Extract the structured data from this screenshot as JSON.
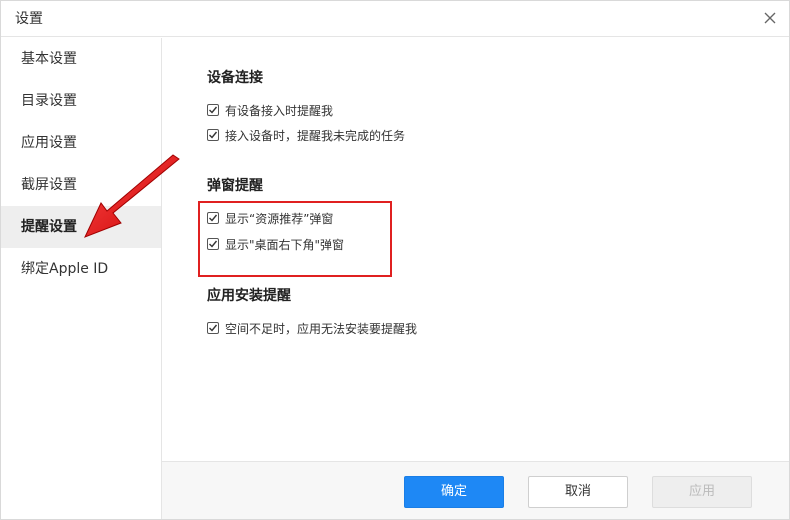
{
  "window": {
    "title": "设置"
  },
  "sidebar": {
    "items": [
      {
        "label": "基本设置"
      },
      {
        "label": "目录设置"
      },
      {
        "label": "应用设置"
      },
      {
        "label": "截屏设置"
      },
      {
        "label": "提醒设置",
        "active": true
      },
      {
        "label": "绑定Apple ID"
      }
    ]
  },
  "content": {
    "sections": [
      {
        "title": "设备连接",
        "options": [
          {
            "label": "有设备接入时提醒我",
            "checked": true
          },
          {
            "label": "接入设备时，提醒我未完成的任务",
            "checked": true
          }
        ]
      },
      {
        "title": "弹窗提醒",
        "options": [
          {
            "label": "显示“资源推荐”弹窗",
            "checked": true
          },
          {
            "label": "显示\"桌面右下角\"弹窗",
            "checked": true
          }
        ]
      },
      {
        "title": "应用安装提醒",
        "options": [
          {
            "label": "空间不足时，应用无法安装要提醒我",
            "checked": true
          }
        ]
      }
    ]
  },
  "footer": {
    "ok_label": "确定",
    "cancel_label": "取消",
    "apply_label": "应用"
  },
  "colors": {
    "primary": "#1e88f5",
    "annotation": "#e02020",
    "active_bg": "#eeeeee"
  },
  "icons": {
    "close": "close-icon",
    "check": "checkmark-icon",
    "annotation": "arrow-annotation"
  }
}
